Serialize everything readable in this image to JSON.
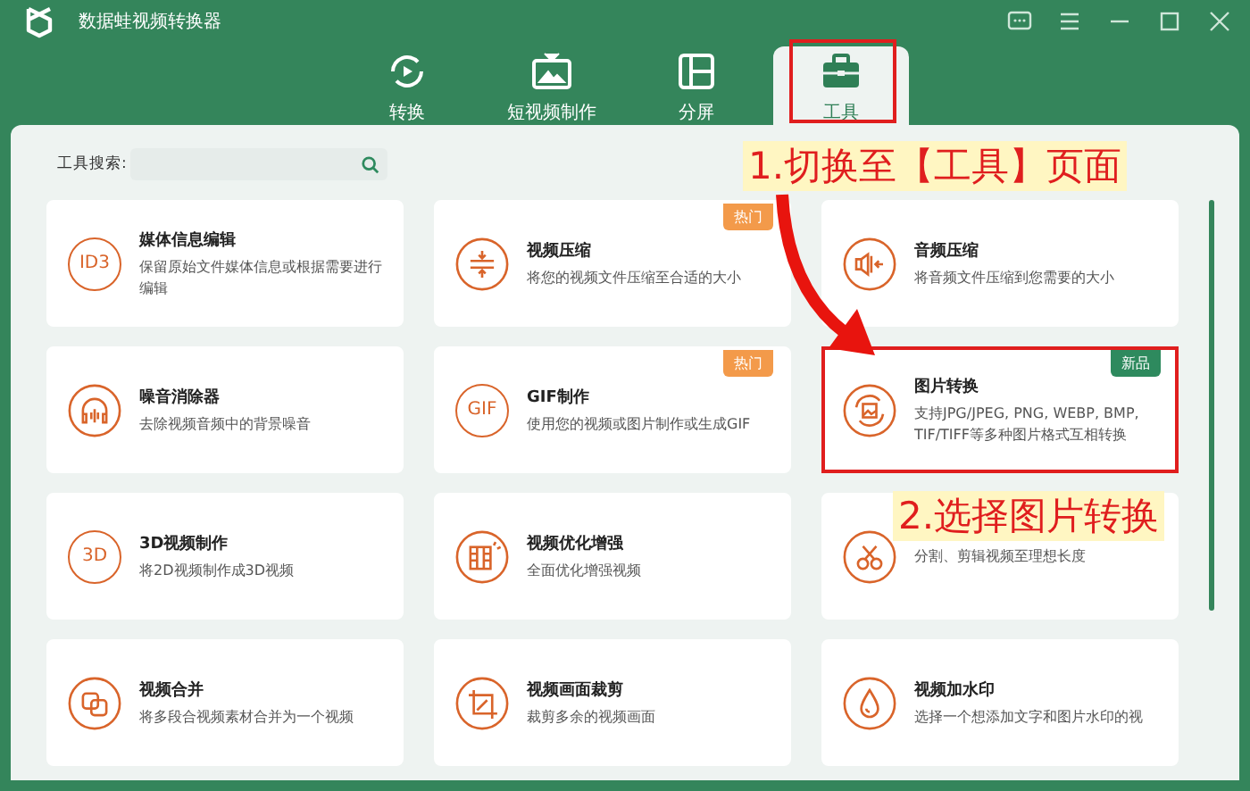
{
  "window": {
    "title": "数据蛙视频转换器"
  },
  "tabs": [
    {
      "label": "转换",
      "selected": false
    },
    {
      "label": "短视频制作",
      "selected": false
    },
    {
      "label": "分屏",
      "selected": false
    },
    {
      "label": "工具",
      "selected": true
    }
  ],
  "search": {
    "label": "工具搜索:"
  },
  "tools": [
    {
      "icon_text": "ID3",
      "title": "媒体信息编辑",
      "desc": "保留原始文件媒体信息或根据需要进行编辑",
      "highlighted": false
    },
    {
      "title": "视频压缩",
      "desc": "将您的视频文件压缩至合适的大小",
      "badge": {
        "kind": "hot",
        "label": "热门"
      },
      "highlighted": false
    },
    {
      "title": "音频压缩",
      "desc": "将音频文件压缩到您需要的大小",
      "highlighted": false
    },
    {
      "title": "噪音消除器",
      "desc": "去除视频音频中的背景噪音",
      "highlighted": false
    },
    {
      "icon_text": "GIF",
      "title": "GIF制作",
      "desc": "使用您的视频或图片制作或生成GIF",
      "badge": {
        "kind": "hot",
        "label": "热门"
      },
      "highlighted": false
    },
    {
      "title": "图片转换",
      "desc": "支持JPG/JPEG, PNG, WEBP, BMP, TIF/TIFF等多种图片格式互相转换",
      "badge": {
        "kind": "new",
        "label": "新品"
      },
      "highlighted": true
    },
    {
      "icon_text": "3D",
      "title": "3D视频制作",
      "desc": "将2D视频制作成3D视频",
      "highlighted": false
    },
    {
      "title": "视频优化增强",
      "desc": "全面优化增强视频",
      "highlighted": false
    },
    {
      "desc": "分割、剪辑视频至理想长度",
      "highlighted": false
    },
    {
      "title": "视频合并",
      "desc": "将多段合视频素材合并为一个视频",
      "highlighted": false
    },
    {
      "title": "视频画面裁剪",
      "desc": "裁剪多余的视频画面",
      "highlighted": false
    },
    {
      "title": "视频加水印",
      "desc": "选择一个想添加文字和图片水印的视",
      "highlighted": false
    }
  ],
  "annotations": [
    {
      "text": "1.切换至【工具】页面"
    },
    {
      "text": "2.选择图片转换"
    }
  ]
}
